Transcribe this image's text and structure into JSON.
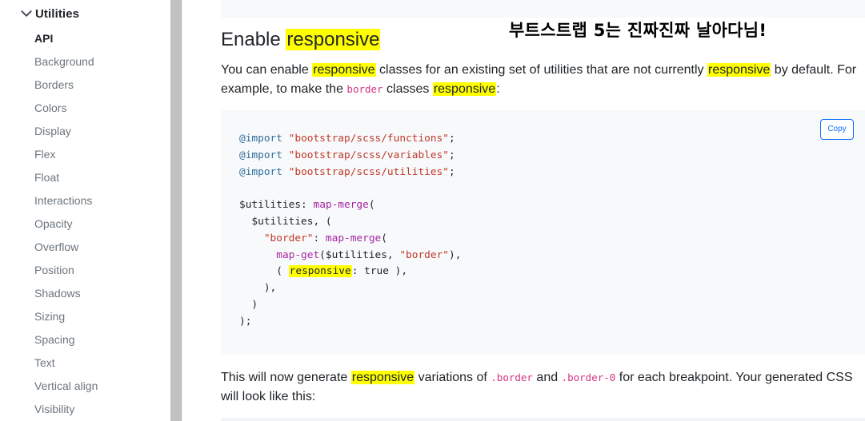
{
  "sidebar": {
    "section_label": "Utilities",
    "items": [
      {
        "label": "API",
        "active": true
      },
      {
        "label": "Background"
      },
      {
        "label": "Borders"
      },
      {
        "label": "Colors"
      },
      {
        "label": "Display"
      },
      {
        "label": "Flex"
      },
      {
        "label": "Float"
      },
      {
        "label": "Interactions"
      },
      {
        "label": "Opacity"
      },
      {
        "label": "Overflow"
      },
      {
        "label": "Position"
      },
      {
        "label": "Shadows"
      },
      {
        "label": "Sizing"
      },
      {
        "label": "Spacing"
      },
      {
        "label": "Text"
      },
      {
        "label": "Vertical align"
      },
      {
        "label": "Visibility"
      }
    ]
  },
  "annotation": "부트스트랩 5는 진짜진짜 날아다님!",
  "main": {
    "heading_prefix": "Enable ",
    "heading_highlight": "responsive",
    "intro": {
      "t1": "You can enable ",
      "h1": "responsive",
      "t2": " classes for an existing set of utilities that are not currently ",
      "h2": "responsive",
      "t3": " by default. For example, to make the ",
      "code1": "border",
      "t4": " classes ",
      "h3": "responsive",
      "t5": ":"
    },
    "copy_label": "Copy",
    "code": {
      "import_kw": "@import",
      "import1": "\"bootstrap/scss/functions\"",
      "import2": "\"bootstrap/scss/variables\"",
      "import3": "\"bootstrap/scss/utilities\"",
      "semicolon": ";",
      "utilities_var": "$utilities",
      "colon": ":",
      "map_merge": "map-merge",
      "open_paren": "(",
      "utilities_arg": "$utilities",
      "comma_paren": ", (",
      "border_key": "\"border\"",
      "map_get": "map-get",
      "map_get_args_1": "($utilities, ",
      "map_get_args_2": "\"border\"",
      "map_get_args_3": "),",
      "resp_open": "( ",
      "resp_word": "responsive",
      "resp_rest": ": true ),",
      "close1": "),",
      "close2": ")",
      "close3": ");"
    },
    "outro": {
      "t1": "This will now generate ",
      "h1": "responsive",
      "t2": " variations of ",
      "code1": ".border",
      "t3": " and ",
      "code2": ".border-0",
      "t4": " for each breakpoint. Your generated CSS will look like this:"
    }
  }
}
